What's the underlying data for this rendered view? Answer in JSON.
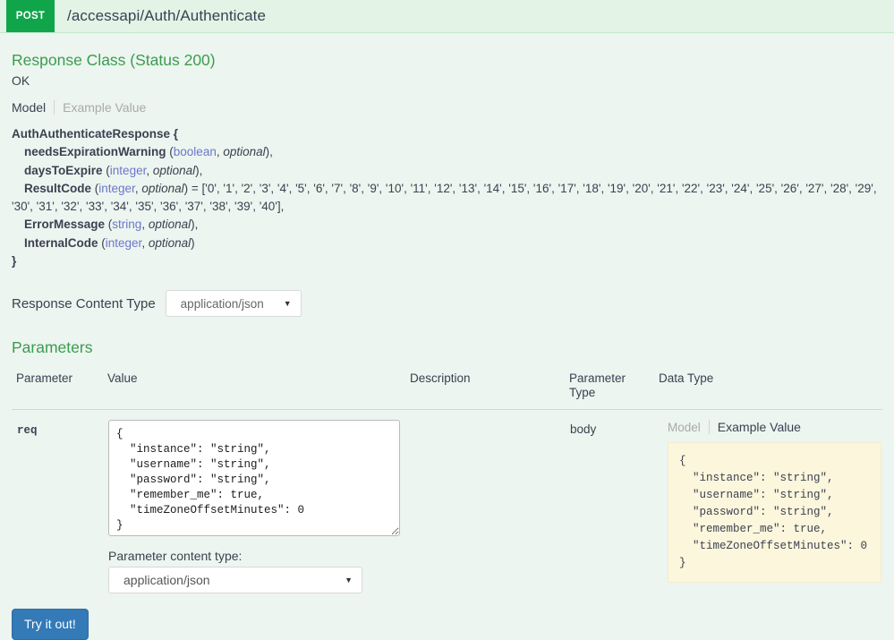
{
  "operation": {
    "method": "POST",
    "path": "/accessapi/Auth/Authenticate"
  },
  "response_class": {
    "heading": "Response Class (Status 200)",
    "status_text": "OK",
    "tabs": {
      "model": "Model",
      "example_value": "Example Value"
    },
    "model": {
      "name": "AuthAuthenticateResponse {",
      "close": "}",
      "properties": [
        {
          "name": "needsExpirationWarning",
          "open": " (",
          "type": "boolean",
          "sep": ", ",
          "required": "optional",
          "close": "),"
        },
        {
          "name": "daysToExpire",
          "open": " (",
          "type": "integer",
          "sep": ", ",
          "required": "optional",
          "close": "),"
        },
        {
          "name": "ResultCode",
          "open": " (",
          "type": "integer",
          "sep": ", ",
          "required": "optional",
          "close": ") = ['0', '1', '2', '3', '4', '5', '6', '7', '8', '9', '10', '11', '12', '13', '14', '15', '16', '17', '18', '19', '20', '21', '22', '23', '24', '25', '26', '27', '28', '29', '30', '31', '32', '33', '34', '35', '36', '37', '38', '39', '40'],"
        },
        {
          "name": "ErrorMessage",
          "open": " (",
          "type": "string",
          "sep": ", ",
          "required": "optional",
          "close": "),"
        },
        {
          "name": "InternalCode",
          "open": " (",
          "type": "integer",
          "sep": ", ",
          "required": "optional",
          "close": ")"
        }
      ]
    }
  },
  "response_content_type": {
    "label": "Response Content Type",
    "value": "application/json",
    "caret": "▼"
  },
  "parameters_section": {
    "title": "Parameters",
    "columns": {
      "parameter": "Parameter",
      "value": "Value",
      "description": "Description",
      "parameter_type": "Parameter\nType",
      "data_type": "Data Type"
    },
    "row": {
      "parameter_name": "req",
      "body_value": "{\n  \"instance\": \"string\",\n  \"username\": \"string\",\n  \"password\": \"string\",\n  \"remember_me\": true,\n  \"timeZoneOffsetMinutes\": 0\n}",
      "description": "",
      "parameter_type": "body",
      "data_type": {
        "tab_model": "Model",
        "tab_example": "Example Value",
        "example_value": "{\n  \"instance\": \"string\",\n  \"username\": \"string\",\n  \"password\": \"string\",\n  \"remember_me\": true,\n  \"timeZoneOffsetMinutes\": 0\n}"
      }
    },
    "param_content_type": {
      "label": "Parameter content type:",
      "value": "application/json",
      "caret": "▼"
    },
    "try_button": "Try it out!"
  },
  "colors": {
    "method_green": "#10a54a",
    "header_bg": "#e3f3e6",
    "body_bg": "#ecf5ef",
    "section_green": "#3b9c4f",
    "type_blue": "#6b77cc",
    "example_yellow": "#fcf6dc",
    "button_blue": "#337ab7"
  }
}
